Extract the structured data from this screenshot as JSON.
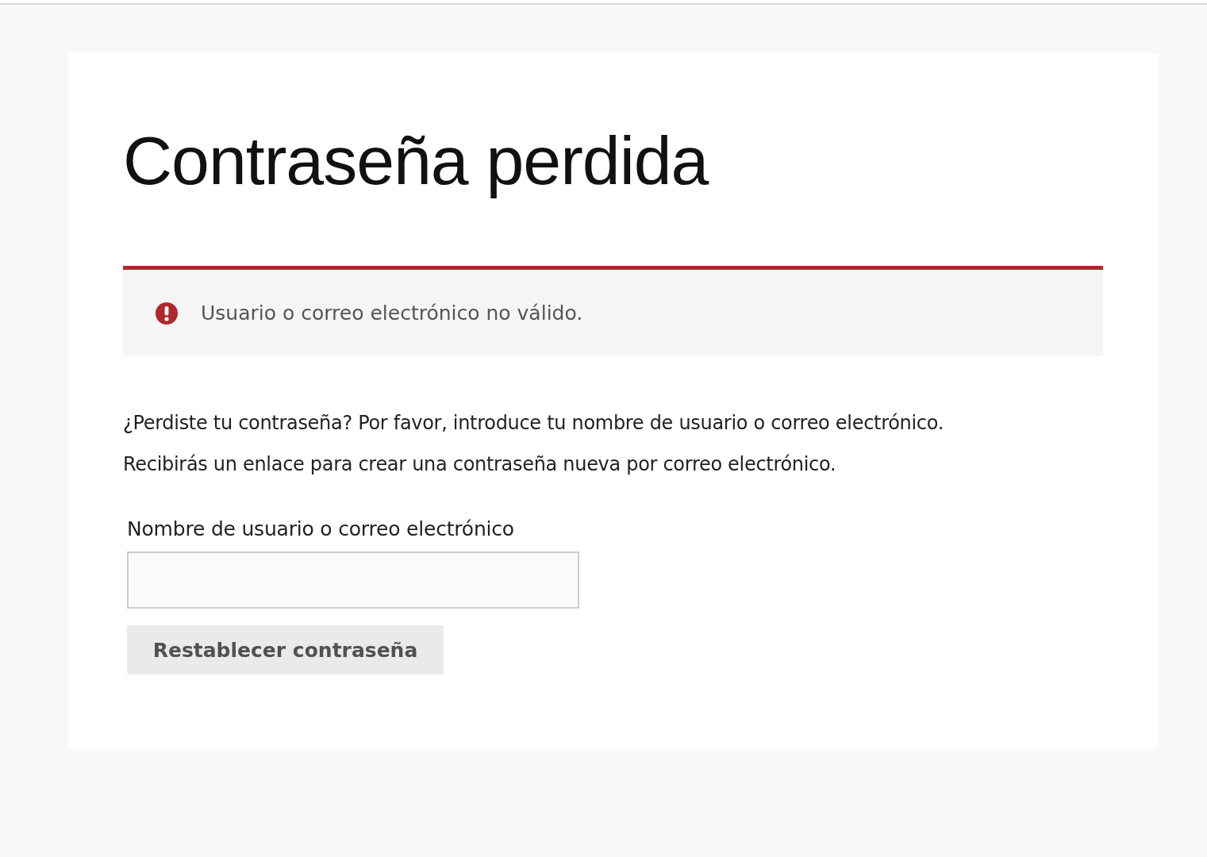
{
  "title": "Contraseña perdida",
  "notice": {
    "kind": "error",
    "message": "Usuario o correo electrónico no válido."
  },
  "intro": [
    "¿Perdiste tu contraseña? Por favor, introduce tu nombre de usuario o correo electrónico.",
    "Recibirás un enlace para crear una contraseña nueva por correo electrónico."
  ],
  "field": {
    "label": "Nombre de usuario o correo electrónico"
  },
  "button": "Restablecer contraseña"
}
